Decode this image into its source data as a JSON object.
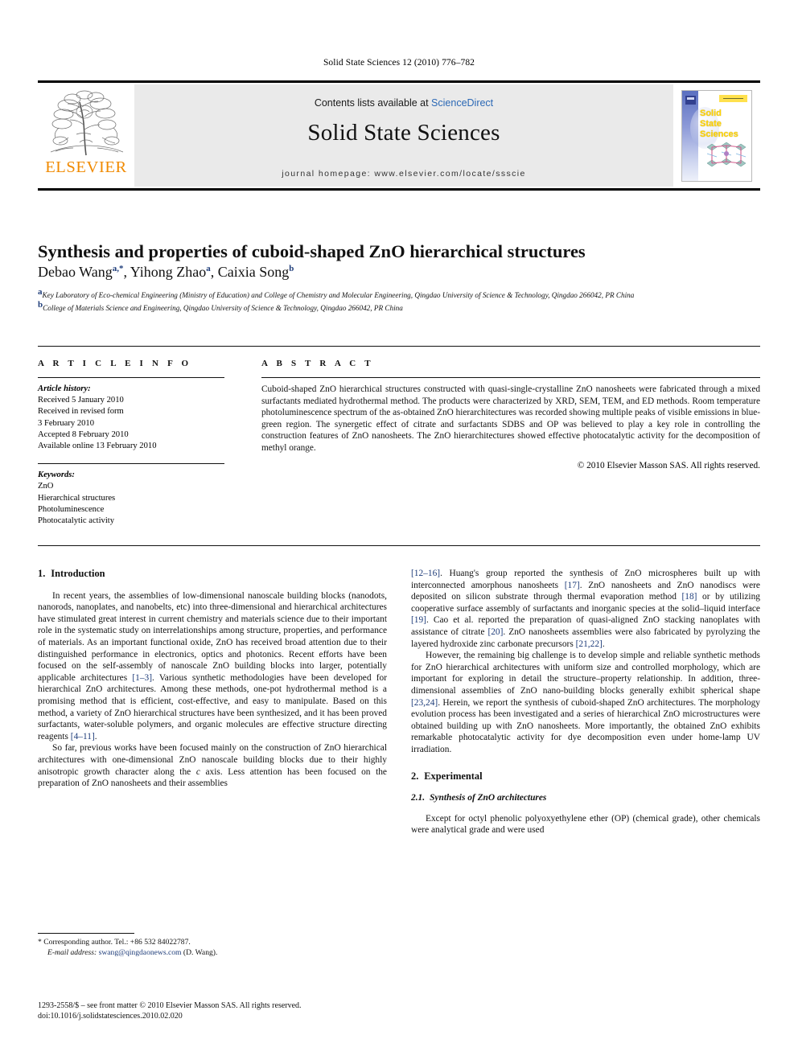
{
  "running_head": "Solid State Sciences 12 (2010) 776–782",
  "masthead": {
    "publisher_name": "ELSEVIER",
    "contents_prefix": "Contents lists available at ",
    "contents_link": "ScienceDirect",
    "journal_title": "Solid State Sciences",
    "homepage": "journal homepage: www.elsevier.com/locate/ssscie",
    "cover_title_line1": "Solid",
    "cover_title_line2": "State",
    "cover_title_line3": "Sciences"
  },
  "article": {
    "title": "Synthesis and properties of cuboid-shaped ZnO hierarchical structures",
    "authors": [
      {
        "name": "Debao Wang",
        "marks": "a,*"
      },
      {
        "name": "Yihong Zhao",
        "marks": "a"
      },
      {
        "name": "Caixia Song",
        "marks": "b"
      }
    ],
    "affiliations": [
      {
        "mark": "a",
        "text": "Key Laboratory of Eco-chemical Engineering (Ministry of Education) and College of Chemistry and Molecular Engineering, Qingdao University of Science & Technology, Qingdao 266042, PR China"
      },
      {
        "mark": "b",
        "text": "College of Materials Science and Engineering, Qingdao University of Science & Technology, Qingdao 266042, PR China"
      }
    ]
  },
  "article_info": {
    "heading": "A R T I C L E   I N F O",
    "history_label": "Article history:",
    "history": [
      "Received 5 January 2010",
      "Received in revised form",
      "3 February 2010",
      "Accepted 8 February 2010",
      "Available online 13 February 2010"
    ],
    "keywords_label": "Keywords:",
    "keywords": [
      "ZnO",
      "Hierarchical structures",
      "Photoluminescence",
      "Photocatalytic activity"
    ]
  },
  "abstract": {
    "heading": "A B S T R A C T",
    "text": "Cuboid-shaped ZnO hierarchical structures constructed with quasi-single-crystalline ZnO nanosheets were fabricated through a mixed surfactants mediated hydrothermal method. The products were characterized by XRD, SEM, TEM, and ED methods. Room temperature photoluminescence spectrum of the as-obtained ZnO hierarchitectures was recorded showing multiple peaks of visible emissions in blue-green region. The synergetic effect of citrate and surfactants SDBS and OP was believed to play a key role in controlling the construction features of ZnO nanosheets. The ZnO hierarchitectures showed effective photocatalytic activity for the decomposition of methyl orange.",
    "copyright": "© 2010 Elsevier Masson SAS. All rights reserved."
  },
  "sections": {
    "introduction": {
      "num": "1.",
      "title": "Introduction",
      "p1_a": "In recent years, the assemblies of low-dimensional nanoscale building blocks (nanodots, nanorods, nanoplates, and nanobelts, etc) into three-dimensional and hierarchical architectures have stimulated great interest in current chemistry and materials science due to their important role in the systematic study on interrelationships among structure, properties, and performance of materials. As an important functional oxide, ZnO has received broad attention due to their distinguished performance in electronics, optics and photonics. Recent efforts have been focused on the self-assembly of nanoscale ZnO building blocks into larger, potentially applicable architectures ",
      "p1_ref1": "[1–3]",
      "p1_b": ". Various synthetic methodologies have been developed for hierarchical ZnO architectures. Among these methods, one-pot hydrothermal method is a promising method that is efficient, cost-effective, and easy to manipulate. Based on this method, a variety of ZnO hierarchical structures have been synthesized, and it has been proved surfactants, water-soluble polymers, and organic molecules are effective structure directing reagents ",
      "p1_ref2": "[4–11]",
      "p1_c": ".",
      "p2_a": "So far, previous works have been focused mainly on the construction of ZnO hierarchical architectures with one-dimensional ZnO nanoscale building blocks due to their highly anisotropic growth character along the ",
      "p2_italic": "c",
      "p2_b": " axis. Less attention has been focused on the preparation of ZnO nanosheets and their assemblies ",
      "p2_ref1": "[12–16]",
      "p2_c": ". Huang's group reported the synthesis of ZnO microspheres built up with interconnected amorphous nanosheets ",
      "p2_ref2": "[17]",
      "p2_d": ". ZnO nanosheets and ZnO nanodiscs were deposited on silicon substrate through thermal evaporation method ",
      "p2_ref3": "[18]",
      "p2_e": " or by utilizing cooperative surface assembly of surfactants and inorganic species at the solid–liquid interface ",
      "p2_ref4": "[19]",
      "p2_f": ". Cao et al. reported the preparation of quasi-aligned ZnO stacking nanoplates with assistance of citrate ",
      "p2_ref5": "[20]",
      "p2_g": ". ZnO nanosheets assemblies were also fabricated by pyrolyzing the layered hydroxide zinc carbonate precursors ",
      "p2_ref6": "[21,22]",
      "p2_h": ".",
      "p3_a": "However, the remaining big challenge is to develop simple and reliable synthetic methods for ZnO hierarchical architectures with uniform size and controlled morphology, which are important for exploring in detail the structure–property relationship. In addition, three-dimensional assemblies of ZnO nano-building blocks generally exhibit spherical shape ",
      "p3_ref1": "[23,24]",
      "p3_b": ". Herein, we report the synthesis of cuboid-shaped ZnO architectures. The morphology evolution process has been investigated and a series of hierarchical ZnO microstructures were obtained building up with ZnO nanosheets. More importantly, the obtained ZnO exhibits remarkable photocatalytic activity for dye decomposition even under home-lamp UV irradiation."
    },
    "experimental": {
      "num": "2.",
      "title": "Experimental",
      "sub_num": "2.1.",
      "sub_title": "Synthesis of ZnO architectures",
      "p1": "Except for octyl phenolic polyoxyethylene ether (OP) (chemical grade), other chemicals were analytical grade and were used"
    }
  },
  "footnotes": {
    "corresponding": "* Corresponding author. Tel.: +86 532 84022787.",
    "email_label": "E-mail address:",
    "email": "swang@qingdaonews.com",
    "email_suffix": " (D. Wang).",
    "issn_line": "1293-2558/$ – see front matter © 2010 Elsevier Masson SAS. All rights reserved.",
    "doi_line": "doi:10.1016/j.solidstatesciences.2010.02.020"
  },
  "colors": {
    "elsevier_orange": "#F08A00",
    "link_blue": "#2b68b5",
    "ref_blue": "#1f3d7a",
    "cover_yellow": "#ffd400"
  }
}
